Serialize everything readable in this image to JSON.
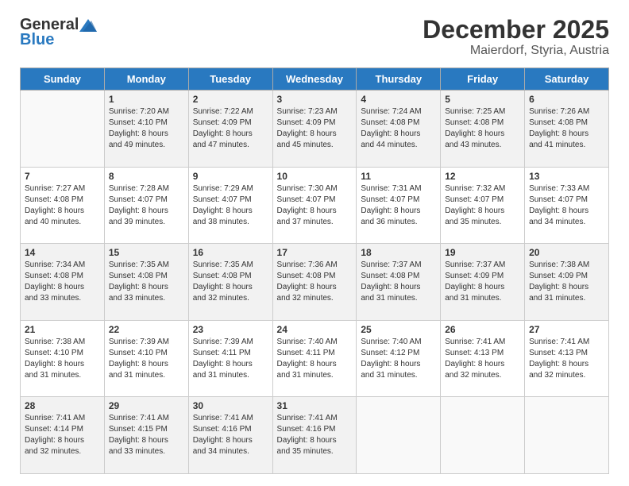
{
  "header": {
    "logo_general": "General",
    "logo_blue": "Blue",
    "month": "December 2025",
    "location": "Maierdorf, Styria, Austria"
  },
  "weekdays": [
    "Sunday",
    "Monday",
    "Tuesday",
    "Wednesday",
    "Thursday",
    "Friday",
    "Saturday"
  ],
  "weeks": [
    [
      {
        "day": "",
        "info": ""
      },
      {
        "day": "1",
        "info": "Sunrise: 7:20 AM\nSunset: 4:10 PM\nDaylight: 8 hours\nand 49 minutes."
      },
      {
        "day": "2",
        "info": "Sunrise: 7:22 AM\nSunset: 4:09 PM\nDaylight: 8 hours\nand 47 minutes."
      },
      {
        "day": "3",
        "info": "Sunrise: 7:23 AM\nSunset: 4:09 PM\nDaylight: 8 hours\nand 45 minutes."
      },
      {
        "day": "4",
        "info": "Sunrise: 7:24 AM\nSunset: 4:08 PM\nDaylight: 8 hours\nand 44 minutes."
      },
      {
        "day": "5",
        "info": "Sunrise: 7:25 AM\nSunset: 4:08 PM\nDaylight: 8 hours\nand 43 minutes."
      },
      {
        "day": "6",
        "info": "Sunrise: 7:26 AM\nSunset: 4:08 PM\nDaylight: 8 hours\nand 41 minutes."
      }
    ],
    [
      {
        "day": "7",
        "info": "Sunrise: 7:27 AM\nSunset: 4:08 PM\nDaylight: 8 hours\nand 40 minutes."
      },
      {
        "day": "8",
        "info": "Sunrise: 7:28 AM\nSunset: 4:07 PM\nDaylight: 8 hours\nand 39 minutes."
      },
      {
        "day": "9",
        "info": "Sunrise: 7:29 AM\nSunset: 4:07 PM\nDaylight: 8 hours\nand 38 minutes."
      },
      {
        "day": "10",
        "info": "Sunrise: 7:30 AM\nSunset: 4:07 PM\nDaylight: 8 hours\nand 37 minutes."
      },
      {
        "day": "11",
        "info": "Sunrise: 7:31 AM\nSunset: 4:07 PM\nDaylight: 8 hours\nand 36 minutes."
      },
      {
        "day": "12",
        "info": "Sunrise: 7:32 AM\nSunset: 4:07 PM\nDaylight: 8 hours\nand 35 minutes."
      },
      {
        "day": "13",
        "info": "Sunrise: 7:33 AM\nSunset: 4:07 PM\nDaylight: 8 hours\nand 34 minutes."
      }
    ],
    [
      {
        "day": "14",
        "info": "Sunrise: 7:34 AM\nSunset: 4:08 PM\nDaylight: 8 hours\nand 33 minutes."
      },
      {
        "day": "15",
        "info": "Sunrise: 7:35 AM\nSunset: 4:08 PM\nDaylight: 8 hours\nand 33 minutes."
      },
      {
        "day": "16",
        "info": "Sunrise: 7:35 AM\nSunset: 4:08 PM\nDaylight: 8 hours\nand 32 minutes."
      },
      {
        "day": "17",
        "info": "Sunrise: 7:36 AM\nSunset: 4:08 PM\nDaylight: 8 hours\nand 32 minutes."
      },
      {
        "day": "18",
        "info": "Sunrise: 7:37 AM\nSunset: 4:08 PM\nDaylight: 8 hours\nand 31 minutes."
      },
      {
        "day": "19",
        "info": "Sunrise: 7:37 AM\nSunset: 4:09 PM\nDaylight: 8 hours\nand 31 minutes."
      },
      {
        "day": "20",
        "info": "Sunrise: 7:38 AM\nSunset: 4:09 PM\nDaylight: 8 hours\nand 31 minutes."
      }
    ],
    [
      {
        "day": "21",
        "info": "Sunrise: 7:38 AM\nSunset: 4:10 PM\nDaylight: 8 hours\nand 31 minutes."
      },
      {
        "day": "22",
        "info": "Sunrise: 7:39 AM\nSunset: 4:10 PM\nDaylight: 8 hours\nand 31 minutes."
      },
      {
        "day": "23",
        "info": "Sunrise: 7:39 AM\nSunset: 4:11 PM\nDaylight: 8 hours\nand 31 minutes."
      },
      {
        "day": "24",
        "info": "Sunrise: 7:40 AM\nSunset: 4:11 PM\nDaylight: 8 hours\nand 31 minutes."
      },
      {
        "day": "25",
        "info": "Sunrise: 7:40 AM\nSunset: 4:12 PM\nDaylight: 8 hours\nand 31 minutes."
      },
      {
        "day": "26",
        "info": "Sunrise: 7:41 AM\nSunset: 4:13 PM\nDaylight: 8 hours\nand 32 minutes."
      },
      {
        "day": "27",
        "info": "Sunrise: 7:41 AM\nSunset: 4:13 PM\nDaylight: 8 hours\nand 32 minutes."
      }
    ],
    [
      {
        "day": "28",
        "info": "Sunrise: 7:41 AM\nSunset: 4:14 PM\nDaylight: 8 hours\nand 32 minutes."
      },
      {
        "day": "29",
        "info": "Sunrise: 7:41 AM\nSunset: 4:15 PM\nDaylight: 8 hours\nand 33 minutes."
      },
      {
        "day": "30",
        "info": "Sunrise: 7:41 AM\nSunset: 4:16 PM\nDaylight: 8 hours\nand 34 minutes."
      },
      {
        "day": "31",
        "info": "Sunrise: 7:41 AM\nSunset: 4:16 PM\nDaylight: 8 hours\nand 35 minutes."
      },
      {
        "day": "",
        "info": ""
      },
      {
        "day": "",
        "info": ""
      },
      {
        "day": "",
        "info": ""
      }
    ]
  ]
}
